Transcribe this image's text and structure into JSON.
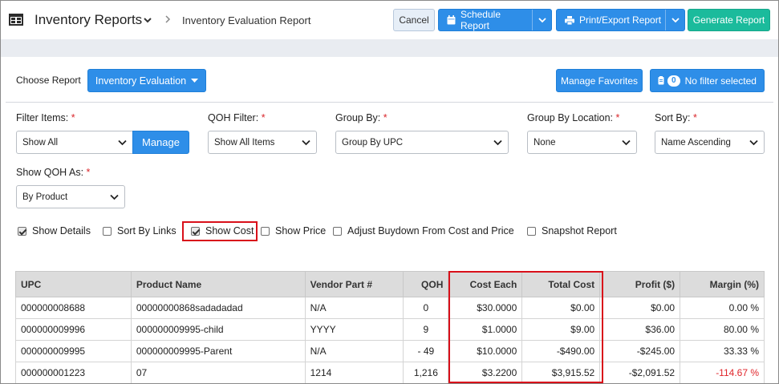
{
  "header": {
    "app_title": "Inventory Reports",
    "breadcrumb": "Inventory Evaluation Report",
    "cancel_label": "Cancel",
    "schedule_label": "Schedule Report",
    "print_label": "Print/Export Report",
    "generate_label": "Generate Report"
  },
  "report": {
    "choose_label": "Choose Report",
    "selected": "Inventory Evaluation",
    "favorites_label": "Manage Favorites",
    "filter_count": "0",
    "filter_label": "No filter selected"
  },
  "filters": {
    "filter_items": {
      "label": "Filter Items:",
      "value": "Show All",
      "manage_label": "Manage"
    },
    "qoh_filter": {
      "label": "QOH Filter:",
      "value": "Show All Items"
    },
    "group_by": {
      "label": "Group By:",
      "value": "Group By UPC"
    },
    "group_by_location": {
      "label": "Group By Location:",
      "value": "None"
    },
    "sort_by": {
      "label": "Sort By:",
      "value": "Name Ascending"
    },
    "show_qoh_as": {
      "label": "Show QOH As:",
      "value": "By Product"
    },
    "required_mark": "*"
  },
  "options": [
    {
      "label": "Show Details",
      "checked": true
    },
    {
      "label": "Sort By Links",
      "checked": false
    },
    {
      "label": "Show Cost",
      "checked": true
    },
    {
      "label": "Show Price",
      "checked": false
    },
    {
      "label": "Adjust Buydown From Cost and Price",
      "checked": false
    },
    {
      "label": "Snapshot Report",
      "checked": false
    }
  ],
  "table": {
    "columns": [
      "UPC",
      "Product Name",
      "Vendor Part #",
      "QOH",
      "Cost Each",
      "Total Cost",
      "Profit ($)",
      "Margin (%)"
    ],
    "rows": [
      [
        "000000008688",
        "00000000868sadadadad",
        "N/A",
        "0",
        "$30.0000",
        "$0.00",
        "$0.00",
        "0.00 %"
      ],
      [
        "000000009996",
        "000000009995-child",
        "YYYY",
        "9",
        "$1.0000",
        "$9.00",
        "$36.00",
        "80.00 %"
      ],
      [
        "000000009995",
        "000000009995-Parent",
        "N/A",
        "- 49",
        "$10.0000",
        "-$490.00",
        "-$245.00",
        "33.33 %"
      ],
      [
        "000000001223",
        "07",
        "1214",
        "1,216",
        "$3.2200",
        "$3,915.52",
        "-$2,091.52",
        "-114.67 %"
      ]
    ]
  },
  "colors": {
    "primary": "#2e8ee8",
    "success": "#1bbb9c",
    "highlight": "#d9101a",
    "negative": "#e0262b"
  }
}
